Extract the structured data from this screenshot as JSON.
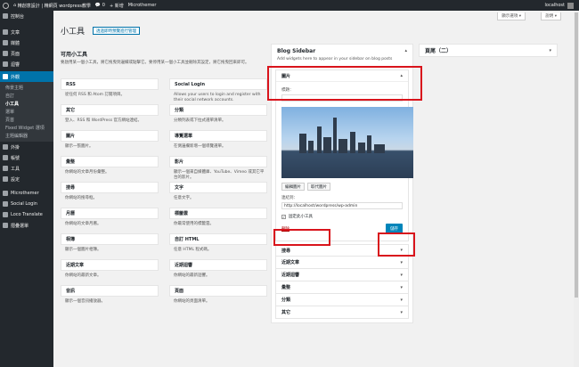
{
  "adminbar": {
    "site": "精創意設計 | 精網頁 wordpress教學",
    "comments": "0",
    "new": "+ 新增",
    "plugin": "Microthemer",
    "user": "localhost"
  },
  "menu": {
    "items": [
      {
        "label": "控制台"
      },
      {
        "label": "文章"
      },
      {
        "label": "媒體"
      },
      {
        "label": "頁面"
      },
      {
        "label": "迴響"
      },
      {
        "label": "外觀"
      }
    ],
    "submenu": [
      "佈景主題",
      "自訂",
      "小工具",
      "選單",
      "頁首",
      "Fixed Widget 選項",
      "主題編輯器"
    ],
    "items2": [
      {
        "label": "外掛"
      },
      {
        "label": "帳號"
      },
      {
        "label": "工具"
      },
      {
        "label": "設定"
      },
      {
        "label": "Microthemer"
      },
      {
        "label": "Social Login"
      },
      {
        "label": "Loco Translate"
      },
      {
        "label": "摺疊選單"
      }
    ]
  },
  "screen_options": "顯示選項 ▾",
  "help": "說明 ▾",
  "page_title": "小工具",
  "manage_button": "透過即時預覽進行管理",
  "available": {
    "heading": "可用小工具",
    "desc": "要啟用某一個小工具，將它拖曳到邊欄或點擊它。要停用某一個小工具並刪除其設定，將它拖曳回來即可。"
  },
  "widgets": [
    {
      "name": "RSS",
      "desc": "從任何 RSS 和 Atom 訂閱項目。"
    },
    {
      "name": "Social Login",
      "desc": "Allows your users to login and register with their social network accounts."
    },
    {
      "name": "其它",
      "desc": "登入、RSS 和 WordPress 官方網站連結。"
    },
    {
      "name": "分類",
      "desc": "分類列表或下拉式選單清單。"
    },
    {
      "name": "圖片",
      "desc": "顯示一張圖片。"
    },
    {
      "name": "導覽選單",
      "desc": "在側邊欄新增一個導覽選單。"
    },
    {
      "name": "彙整",
      "desc": "你網站的文章月份彙整。"
    },
    {
      "name": "影片",
      "desc": "顯示一個來自媒體庫、YouTube、Vimeo 或其它平台的影片。"
    },
    {
      "name": "搜尋",
      "desc": "你網站的搜尋框。"
    },
    {
      "name": "文字",
      "desc": "任意文字。"
    },
    {
      "name": "月曆",
      "desc": "你網站的文章月曆。"
    },
    {
      "name": "標籤雲",
      "desc": "你最常使用的標籤雲。"
    },
    {
      "name": "相簿",
      "desc": "顯示一個圖片相簿。"
    },
    {
      "name": "自訂 HTML",
      "desc": "任意 HTML 程式碼。"
    },
    {
      "name": "近期文章",
      "desc": "你網站的最新文章。"
    },
    {
      "name": "近期迴響",
      "desc": "你網站的最新迴響。"
    },
    {
      "name": "音訊",
      "desc": "顯示一個音訊播放器。"
    },
    {
      "name": "頁面",
      "desc": "你網站的頁面清單。"
    }
  ],
  "sidebar": {
    "title": "Blog Sidebar",
    "desc": "Add widgets here to appear in your sidebar on blog posts"
  },
  "image_widget": {
    "title": "圖片",
    "title_label": "標題：",
    "title_value": "",
    "edit_btn": "編輯圖片",
    "replace_btn": "取代圖片",
    "link_label": "連結到：",
    "link_value": "http://localhost/wordpress/wp-admin",
    "checkbox_label": "固定此小工具",
    "delete": "刪除",
    "save": "儲存"
  },
  "sidebar_widgets": [
    "搜尋",
    "近期文章",
    "近期迴響",
    "彙整",
    "分類",
    "其它"
  ],
  "page_sidebar": "頁尾（二）"
}
